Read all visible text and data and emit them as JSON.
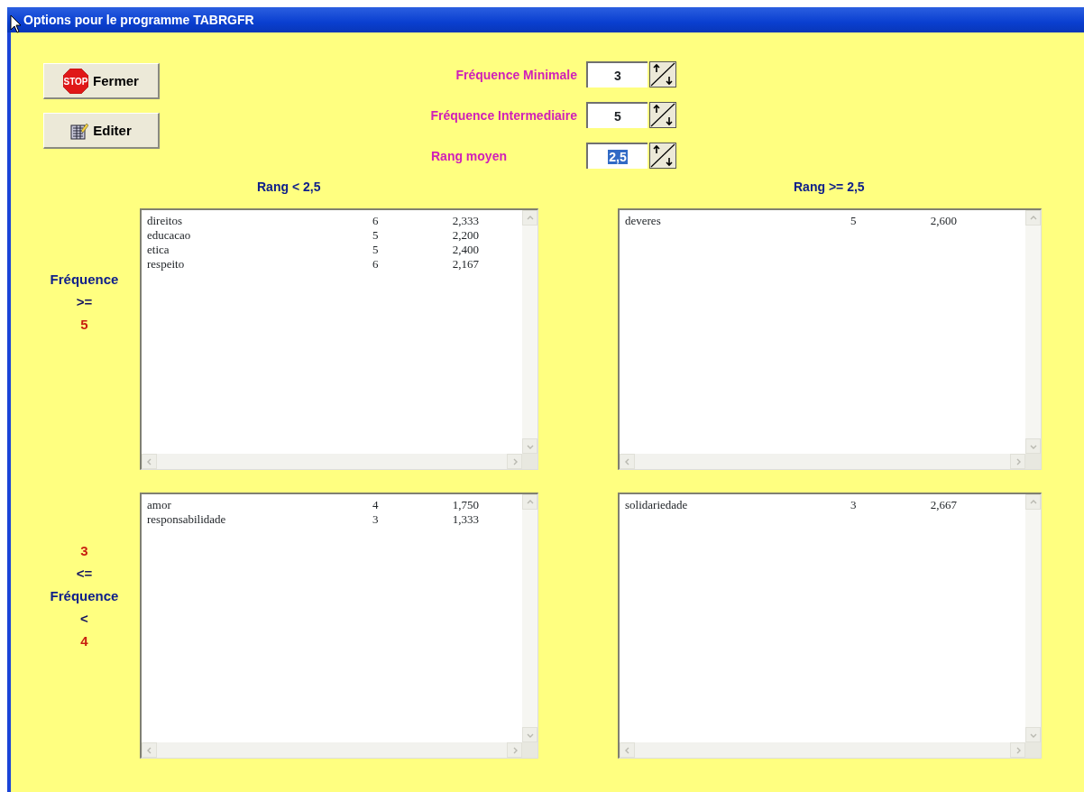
{
  "window": {
    "title": "Options pour le programme TABRGFR"
  },
  "buttons": [
    {
      "label": "Fermer",
      "kind": "stop",
      "icon_text": "STOP"
    },
    {
      "label": "Editer",
      "kind": "edit"
    }
  ],
  "parameters": [
    {
      "label": "Fréquence Minimale",
      "value": "3",
      "selected": false
    },
    {
      "label": "Fréquence Intermediaire",
      "value": "5",
      "selected": false
    },
    {
      "label": "Rang moyen",
      "value": "2,5",
      "selected": true
    }
  ],
  "column_headers": [
    "Rang < 2,5",
    "Rang >= 2,5"
  ],
  "row_labels": [
    {
      "lines": [
        {
          "text": "Fréquence",
          "kind": "word"
        },
        {
          "text": ">=",
          "kind": "operator"
        },
        {
          "text": "5",
          "kind": "number"
        }
      ]
    },
    {
      "lines": [
        {
          "text": "3",
          "kind": "number"
        },
        {
          "text": "<=",
          "kind": "operator"
        },
        {
          "text": "Fréquence",
          "kind": "word"
        },
        {
          "text": "<",
          "kind": "operator"
        },
        {
          "text": "4",
          "kind": "number"
        }
      ]
    }
  ],
  "lists": [
    {
      "rows": [
        [
          "direitos",
          "6",
          "2,333"
        ],
        [
          "educacao",
          "5",
          "2,200"
        ],
        [
          "etica",
          "5",
          "2,400"
        ],
        [
          "respeito",
          "6",
          "2,167"
        ]
      ]
    },
    {
      "rows": [
        [
          "deveres",
          "5",
          "2,600"
        ]
      ]
    },
    {
      "rows": [
        [
          "amor",
          "4",
          "1,750"
        ],
        [
          "responsabilidade",
          "3",
          "1,333"
        ]
      ]
    },
    {
      "rows": [
        [
          "solidariedade",
          "3",
          "2,667"
        ]
      ]
    }
  ]
}
